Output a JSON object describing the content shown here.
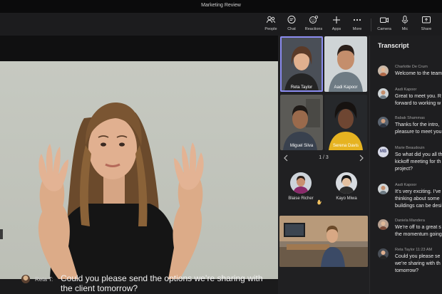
{
  "window": {
    "title": "Marketing Review"
  },
  "toolbar": {
    "people": "People",
    "chat": "Chat",
    "reactions": "Reactions",
    "apps": "Apps",
    "more": "More",
    "camera": "Camera",
    "mic": "Mic",
    "share": "Share"
  },
  "grid": {
    "tiles": [
      {
        "name": "Reta Taylor"
      },
      {
        "name": "Aadi Kapoor"
      },
      {
        "name": "Miguel Silva"
      },
      {
        "name": "Serena Davis"
      }
    ],
    "pager": "1 / 3",
    "avatars": [
      {
        "name": "Blaise Richer"
      },
      {
        "name": "Kayo Miwa"
      }
    ]
  },
  "caption": {
    "speaker": "Reta T:",
    "text": "Could you please send the options we’re sharing with the client tomorrow?"
  },
  "transcript": {
    "title": "Transcript",
    "entries": [
      {
        "meta": "Charlotte De Crum",
        "text": "Welcome to the team"
      },
      {
        "meta": "Aadi Kapoor",
        "text": "Great to meet you. R forward to working w"
      },
      {
        "meta": "Babak Shammas",
        "text": "Thanks for the intro, pleasure to meet you"
      },
      {
        "meta": "Marie Beaudouin",
        "initials": "MB",
        "text": "So what did you all th kickoff meeting for th project?"
      },
      {
        "meta": "Aadi Kapoor",
        "text": "It’s very exciting. I’ve thinking about some buildings can be desi"
      },
      {
        "meta": "Daniela Mandera",
        "text": "We’re off to a great s the momentum going"
      },
      {
        "meta": "Reta Taylor   11:23 AM",
        "text": "Could you please se we’re sharing with th tomorrow?"
      }
    ]
  },
  "colors": {
    "accent": "#8b8cf0",
    "panel": "#1e1e20",
    "toolbar": "#1c1c1e"
  }
}
